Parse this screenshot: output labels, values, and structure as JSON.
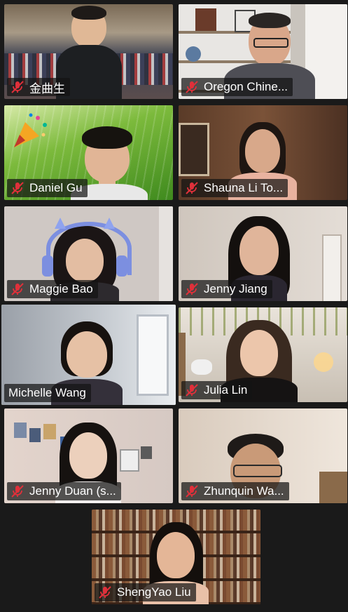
{
  "participants": [
    {
      "name": "金曲生",
      "muted": true,
      "active": false
    },
    {
      "name": "Oregon Chine...",
      "muted": true,
      "active": false
    },
    {
      "name": "Daniel Gu",
      "muted": true,
      "active": false
    },
    {
      "name": "Shauna Li To...",
      "muted": true,
      "active": false
    },
    {
      "name": "Maggie Bao",
      "muted": true,
      "active": false
    },
    {
      "name": "Jenny Jiang",
      "muted": true,
      "active": false
    },
    {
      "name": "Michelle Wang",
      "muted": false,
      "active": true
    },
    {
      "name": "Julia Lin",
      "muted": true,
      "active": false
    },
    {
      "name": "Jenny Duan (s...",
      "muted": true,
      "active": false
    },
    {
      "name": "Zhunquin Wa...",
      "muted": true,
      "active": false
    },
    {
      "name": "ShengYao Liu",
      "muted": true,
      "active": false
    }
  ],
  "icons": {
    "muted_mic": "mic-muted-icon"
  },
  "colors": {
    "active_border": "#d9f26b",
    "muted_icon": "#e0303a",
    "background": "#1a1a1a"
  }
}
